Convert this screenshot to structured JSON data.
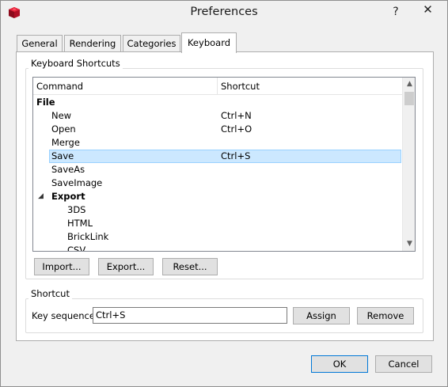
{
  "window": {
    "title": "Preferences",
    "help_label": "?",
    "close_label": "✕"
  },
  "tabs": [
    {
      "label": "General",
      "active": false
    },
    {
      "label": "Rendering",
      "active": false
    },
    {
      "label": "Categories",
      "active": false
    },
    {
      "label": "Keyboard",
      "active": true
    }
  ],
  "shortcuts_group": {
    "title": "Keyboard Shortcuts",
    "columns": {
      "command": "Command",
      "shortcut": "Shortcut"
    },
    "rows": [
      {
        "command": "File",
        "shortcut": "",
        "level": 0,
        "bold": true,
        "expander": ""
      },
      {
        "command": "New",
        "shortcut": "Ctrl+N",
        "level": 1,
        "bold": false,
        "expander": ""
      },
      {
        "command": "Open",
        "shortcut": "Ctrl+O",
        "level": 1,
        "bold": false,
        "expander": ""
      },
      {
        "command": "Merge",
        "shortcut": "",
        "level": 1,
        "bold": false,
        "expander": ""
      },
      {
        "command": "Save",
        "shortcut": "Ctrl+S",
        "level": 1,
        "bold": false,
        "expander": "",
        "selected": true
      },
      {
        "command": "SaveAs",
        "shortcut": "",
        "level": 1,
        "bold": false,
        "expander": ""
      },
      {
        "command": "SaveImage",
        "shortcut": "",
        "level": 1,
        "bold": false,
        "expander": ""
      },
      {
        "command": "Export",
        "shortcut": "",
        "level": 1,
        "bold": true,
        "expander": "◢"
      },
      {
        "command": "3DS",
        "shortcut": "",
        "level": 2,
        "bold": false,
        "expander": ""
      },
      {
        "command": "HTML",
        "shortcut": "",
        "level": 2,
        "bold": false,
        "expander": ""
      },
      {
        "command": "BrickLink",
        "shortcut": "",
        "level": 2,
        "bold": false,
        "expander": ""
      },
      {
        "command": "CSV",
        "shortcut": "",
        "level": 2,
        "bold": false,
        "expander": ""
      }
    ],
    "buttons": {
      "import": "Import...",
      "export": "Export...",
      "reset": "Reset..."
    }
  },
  "shortcut_group": {
    "title": "Shortcut",
    "key_sequence_label": "Key sequence:",
    "key_sequence_value": "Ctrl+S",
    "assign": "Assign",
    "remove": "Remove"
  },
  "footer": {
    "ok": "OK",
    "cancel": "Cancel"
  },
  "colors": {
    "selection_fill": "#cce8ff",
    "selection_border": "#99d1ff",
    "default_button_border": "#0078d7",
    "app_icon": "#c8102e"
  }
}
